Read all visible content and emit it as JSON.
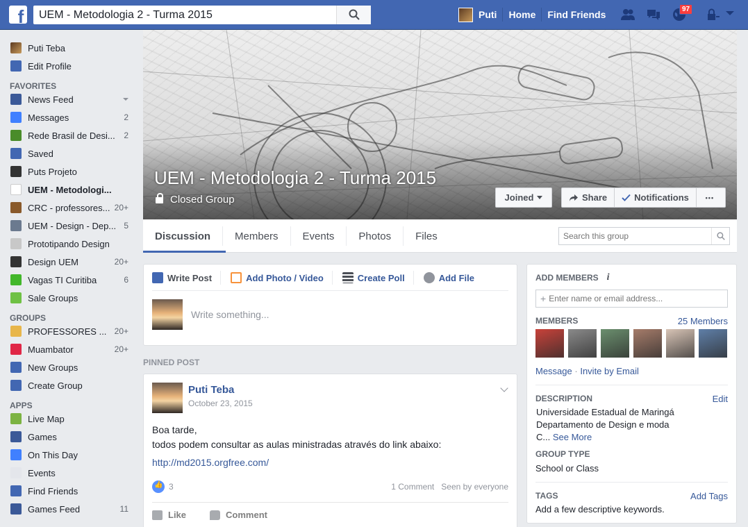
{
  "topbar": {
    "logo": "f",
    "search_value": "UEM - Metodologia 2 - Turma 2015",
    "user_name": "Puti",
    "home": "Home",
    "find_friends": "Find Friends",
    "notifications_count": "97",
    "icons": [
      "search-icon",
      "friend-requests-icon",
      "messages-icon",
      "notifications-globe-icon",
      "privacy-lock-icon",
      "account-menu-caret-icon"
    ]
  },
  "sidebar": {
    "profile": [
      {
        "label": "Puti Teba",
        "icon": "profile-avatar"
      },
      {
        "label": "Edit Profile",
        "icon": "edit-icon"
      }
    ],
    "favorites_heading": "FAVORITES",
    "favorites": [
      {
        "label": "News Feed",
        "count": "",
        "icon": "news-feed-icon",
        "color": "#3b5998"
      },
      {
        "label": "Messages",
        "count": "2",
        "icon": "messages-icon",
        "color": "#4080ff"
      },
      {
        "label": "Rede Brasil de Desi...",
        "count": "2",
        "icon": "tree-group-icon",
        "color": "#4a8c2a"
      },
      {
        "label": "Saved",
        "count": "",
        "icon": "bookmark-icon",
        "color": "#4267b2"
      },
      {
        "label": "Puts Projeto",
        "count": "",
        "icon": "graduation-cap-icon",
        "color": "#333333"
      },
      {
        "label": "UEM - Metodologi...",
        "count": "",
        "icon": "cup-icon",
        "color": "#ffffff"
      },
      {
        "label": "CRC - professores...",
        "count": "20+",
        "icon": "plant-icon",
        "color": "#8a5a2b"
      },
      {
        "label": "UEM - Design - Dep...",
        "count": "5",
        "icon": "group-photo-icon",
        "color": "#6b7a8f"
      },
      {
        "label": "Prototipando Design",
        "count": "",
        "icon": "music-note-icon",
        "color": "#c8c8c8"
      },
      {
        "label": "Design UEM",
        "count": "20+",
        "icon": "graduation-cap-icon",
        "color": "#333333"
      },
      {
        "label": "Vagas TI Curitiba",
        "count": "6",
        "icon": "puzzle-icon",
        "color": "#42b72a"
      },
      {
        "label": "Sale Groups",
        "count": "",
        "icon": "sale-tag-icon",
        "color": "#6fc144"
      }
    ],
    "groups_heading": "GROUPS",
    "groups": [
      {
        "label": "PROFESSORES ...",
        "count": "20+",
        "icon": "house-icon",
        "color": "#e8b64a"
      },
      {
        "label": "Muambator",
        "count": "20+",
        "icon": "heart-icon",
        "color": "#e02646"
      },
      {
        "label": "New Groups",
        "count": "",
        "icon": "people-icon",
        "color": "#4267b2"
      },
      {
        "label": "Create Group",
        "count": "",
        "icon": "plus-icon",
        "color": "#4267b2"
      }
    ],
    "apps_heading": "APPS",
    "apps": [
      {
        "label": "Live Map",
        "count": "",
        "icon": "bar-chart-icon",
        "color": "#7cb342"
      },
      {
        "label": "Games",
        "count": "",
        "icon": "games-icon",
        "color": "#3b5998"
      },
      {
        "label": "On This Day",
        "count": "",
        "icon": "clock-icon",
        "color": "#4080ff"
      },
      {
        "label": "Events",
        "count": "",
        "icon": "calendar-icon",
        "color": "#e4e6eb"
      },
      {
        "label": "Find Friends",
        "count": "",
        "icon": "find-friends-icon",
        "color": "#4267b2"
      },
      {
        "label": "Games Feed",
        "count": "11",
        "icon": "games-feed-icon",
        "color": "#3b5998"
      }
    ]
  },
  "cover": {
    "title": "UEM - Metodologia 2 - Turma 2015",
    "privacy": "Closed Group",
    "joined": "Joined",
    "share": "Share",
    "notifications": "Notifications",
    "more": "•••"
  },
  "tabs": {
    "items": [
      "Discussion",
      "Members",
      "Events",
      "Photos",
      "Files"
    ],
    "search_placeholder": "Search this group"
  },
  "composer": {
    "write_post": "Write Post",
    "add_photo": "Add Photo / Video",
    "create_poll": "Create Poll",
    "add_file": "Add File",
    "placeholder": "Write something..."
  },
  "pinned_label": "PINNED POST",
  "post": {
    "author": "Puti Teba",
    "date": "October 23, 2015",
    "line1": "Boa tarde,",
    "line2": "todos podem consultar as aulas ministradas através do link abaixo:",
    "link": "http://md2015.orgfree.com/",
    "likes": "3",
    "comments": "1 Comment",
    "seen": "Seen by everyone",
    "like_btn": "Like",
    "comment_btn": "Comment"
  },
  "right": {
    "add_members": "ADD MEMBERS",
    "info": "i",
    "add_placeholder": "Enter name or email address...",
    "members": "MEMBERS",
    "members_count": "25 Members",
    "member_colors": [
      "#c8423a",
      "#8a8a8a",
      "#6b8f6e",
      "#a67c6a",
      "#d8c4b6",
      "#5f7fa8"
    ],
    "message": "Message",
    "dot": "·",
    "invite": "Invite by Email",
    "description": "DESCRIPTION",
    "edit": "Edit",
    "desc1": "Universidade Estadual de Maringá",
    "desc2": "Departamento de Design e moda",
    "desc3": "C...",
    "see_more": "See More",
    "group_type": "GROUP TYPE",
    "group_type_val": "School or Class",
    "tags": "TAGS",
    "add_tags": "Add Tags",
    "tags_val": "Add a few descriptive keywords."
  }
}
